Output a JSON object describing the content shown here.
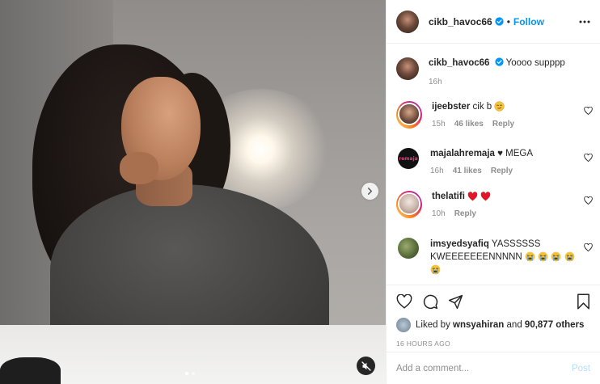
{
  "post": {
    "author": "cikb_havoc66",
    "verified": true,
    "follow_label": "Follow",
    "separator": "•",
    "caption": "Yoooo supppp",
    "caption_time": "16h",
    "media": {
      "slide_count": 2,
      "active_slide": 1
    }
  },
  "comments": [
    {
      "user": "ijeebster",
      "text": "cik b",
      "emojis": [
        "smirk-emoji"
      ],
      "time": "15h",
      "likes": "46 likes",
      "reply": "Reply"
    },
    {
      "user": "majalahremaja",
      "text": "♥ MEGA",
      "emojis": [],
      "time": "16h",
      "likes": "41 likes",
      "reply": "Reply"
    },
    {
      "user": "thelatifi",
      "text": "",
      "emojis": [
        "red-heart-emoji",
        "red-heart-emoji"
      ],
      "time": "10h",
      "likes": "",
      "reply": "Reply"
    },
    {
      "user": "imsyedsyafiq",
      "text": "YASSSSSS KWEEEEEEENNNNN",
      "emojis": [
        "sob-emoji",
        "sob-emoji",
        "sob-emoji",
        "sob-emoji",
        "sob-emoji"
      ],
      "time": "",
      "likes": "",
      "reply": ""
    }
  ],
  "engagement": {
    "liked_by_prefix": "Liked by",
    "liked_by_user": "wnsyahiran",
    "and_label": "and",
    "others": "90,877 others",
    "timestamp": "16 HOURS AGO"
  },
  "composer": {
    "placeholder": "Add a comment...",
    "post_label": "Post"
  },
  "colors": {
    "accent": "#0095f6",
    "muted": "#8e8e8e",
    "heart": "#ed4956",
    "post_disabled": "#b2dffc"
  }
}
